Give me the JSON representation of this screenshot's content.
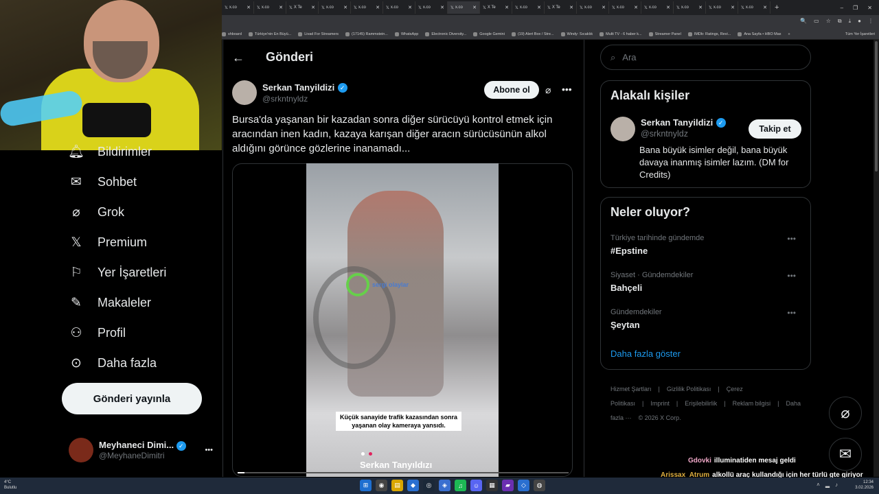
{
  "browser": {
    "tabs": [
      "x.co",
      "x.co",
      "X Te",
      "x.co",
      "x.co",
      "x.co",
      "x.co",
      "x.co",
      "X Te",
      "x.co",
      "X Te",
      "x.co",
      "x.co",
      "x.co",
      "x.co",
      "x.co",
      "x.co"
    ],
    "active_tab": 7,
    "new_tab": "+"
  },
  "bookmarks": [
    "shboard",
    "Türkiye'nin En Büyü...",
    "Livad For Streamers",
    "(17145) Rammstein...",
    "WhatsApp",
    "Electronic Diversity...",
    "Google Gemini",
    "(19) Alert Box / Stre...",
    "Windy: Sıcaklık",
    "Multi TV - 6 haber k...",
    "Streamer Panel",
    "IMDb: Ratings, Revi...",
    "Ana Sayfa • HBO Max"
  ],
  "bookmarks_more": "»",
  "bookmarks_all": "Tüm Yer İşaretleri",
  "nav": [
    {
      "label": "Bildirimler",
      "icon": "bell-icon"
    },
    {
      "label": "Sohbet",
      "icon": "mail-icon"
    },
    {
      "label": "Grok",
      "icon": "grok-icon"
    },
    {
      "label": "Premium",
      "icon": "x-logo-icon"
    },
    {
      "label": "Yer İşaretleri",
      "icon": "bookmark-icon"
    },
    {
      "label": "Makaleler",
      "icon": "article-icon"
    },
    {
      "label": "Profil",
      "icon": "person-icon"
    },
    {
      "label": "Daha fazla",
      "icon": "more-circle-icon"
    }
  ],
  "post_button": "Gönderi yayınla",
  "account": {
    "name": "Meyhaneci Dimi...",
    "handle": "@MeyhaneDimitri",
    "more": "•••"
  },
  "header": {
    "back": "←",
    "title": "Gönderi"
  },
  "post": {
    "author_name": "Serkan Tanyildizi",
    "author_handle": "@srkntnyldz",
    "subscribe": "Abone ol",
    "more": "•••",
    "text": "Bursa'da yaşanan bir kazadan sonra diğer sürücüyü kontrol etmek için aracından inen kadın, kazaya karışan diğer aracın sürücüsünün alkol aldığını görünce gözlerine inanamadı...",
    "video_logo_text": "sergi olaylar",
    "video_caption": "Küçük sanayide trafik kazasından sonra yaşanan olay kameraya yansıdı.",
    "video_name": "Serkan Tanyıldızı",
    "video_progress_pct": 2
  },
  "search": {
    "placeholder": "Ara"
  },
  "related": {
    "title": "Alakalı kişiler",
    "name": "Serkan Tanyildizi",
    "handle": "@srkntnyldz",
    "follow": "Takip et",
    "bio": "Bana büyük isimler değil, bana büyük davaya inanmış isimler lazım. (DM for Credits)"
  },
  "trends": {
    "title": "Neler oluyor?",
    "items": [
      {
        "category": "Türkiye tarihinde gündemde",
        "name": "#Epstine"
      },
      {
        "category": "Siyaset · Gündemdekiler",
        "name": "Bahçeli"
      },
      {
        "category": "Gündemdekiler",
        "name": "Şeytan"
      }
    ],
    "more_dots": "•••",
    "show_more": "Daha fazla göster"
  },
  "footer": [
    "Hizmet Şartları",
    "|",
    "Gizlilik Politikası",
    "|",
    "Çerez Politikası",
    "|",
    "Imprint",
    "|",
    "Erişilebilirlik",
    "|",
    "Reklam bilgisi",
    "|",
    "Daha fazla ···",
    "© 2026 X Corp."
  ],
  "chat": [
    {
      "user": "Gdovki",
      "msg": "illuminatiden mesaj geldi"
    },
    {
      "user": "Arissax_Atrum",
      "msg": "alkollü araç kullandığı için her türlü gte giriyor tabi"
    }
  ],
  "taskbar": {
    "weather_temp": "4°C",
    "weather_desc": "Bulutlu",
    "time": "12:34",
    "date": "3.02.2026"
  },
  "colors": {
    "accent": "#1d9bf0",
    "bg": "#000000",
    "text": "#e7e9ea",
    "muted": "#71767b"
  }
}
